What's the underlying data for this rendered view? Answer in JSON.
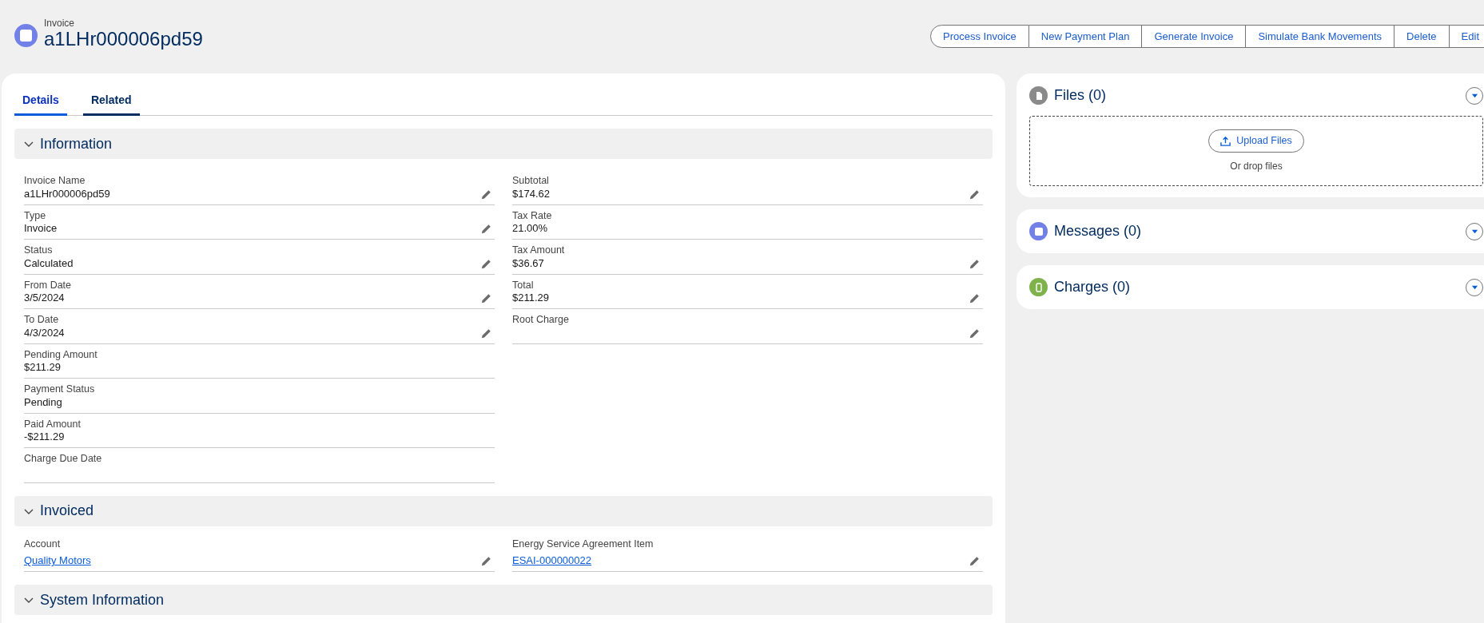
{
  "header": {
    "object_type": "Invoice",
    "title": "a1LHr000006pd59"
  },
  "actions": [
    "Process Invoice",
    "New Payment Plan",
    "Generate Invoice",
    "Simulate Bank Movements",
    "Delete",
    "Edit"
  ],
  "tabs": [
    {
      "label": "Details",
      "selected": true
    },
    {
      "label": "Related",
      "selected": false
    }
  ],
  "sections": [
    {
      "title": "Information",
      "expanded": true,
      "columns": [
        [
          {
            "label": "Invoice Name",
            "value": "a1LHr000006pd59",
            "kind": "text",
            "editable": true
          },
          {
            "label": "Type",
            "value": "Invoice",
            "kind": "text",
            "editable": true
          },
          {
            "label": "Status",
            "value": "Calculated",
            "kind": "text",
            "editable": true
          },
          {
            "label": "From Date",
            "value": "3/5/2024",
            "kind": "text",
            "editable": true
          },
          {
            "label": "To Date",
            "value": "4/3/2024",
            "kind": "text",
            "editable": true
          },
          {
            "label": "Pending Amount",
            "value": "$211.29",
            "kind": "text",
            "editable": false
          },
          {
            "label": "Payment Status",
            "value": "Pending",
            "kind": "text",
            "editable": false
          },
          {
            "label": "Paid Amount",
            "value": "-$211.29",
            "kind": "text",
            "editable": false
          },
          {
            "label": "Charge Due Date",
            "kind": "text",
            "editable": false
          }
        ],
        [
          {
            "label": "Subtotal",
            "value": "$174.62",
            "kind": "text",
            "editable": true
          },
          {
            "label": "Tax Rate",
            "value": "21.00%",
            "kind": "text",
            "editable": false
          },
          {
            "label": "Tax Amount",
            "value": "$36.67",
            "kind": "text",
            "editable": true
          },
          {
            "label": "Total",
            "value": "$211.29",
            "kind": "text",
            "editable": true
          },
          {
            "label": "Root Charge",
            "kind": "text",
            "editable": true
          }
        ]
      ]
    },
    {
      "title": "Invoiced",
      "expanded": true,
      "columns": [
        [
          {
            "label": "Account",
            "value": "Quality Motors",
            "kind": "link",
            "editable": true
          }
        ],
        [
          {
            "label": "Energy Service Agreement Item",
            "value": "ESAI-000000022",
            "kind": "link",
            "editable": true
          }
        ]
      ]
    },
    {
      "title": "System Information",
      "expanded": true
    }
  ],
  "related": [
    {
      "title": "Files (0)",
      "kind": "files",
      "upload_label": "Upload Files",
      "drop_hint": "Or drop files"
    },
    {
      "title": "Messages (0)",
      "kind": "messages"
    },
    {
      "title": "Charges (0)",
      "kind": "charges"
    }
  ]
}
